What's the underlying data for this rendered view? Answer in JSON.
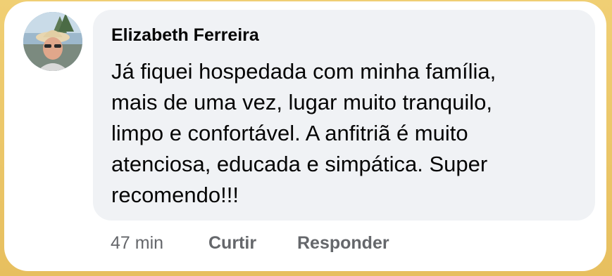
{
  "comment": {
    "author": "Elizabeth Ferreira",
    "lines": [
      "Já fiquei hospedada com minha família,",
      "mais de uma vez, lugar muito tranquilo,",
      "limpo e confortável. A anfitriã é muito",
      "atenciosa, educada e simpática. Super",
      "recomendo!!!"
    ],
    "time": "47 min",
    "like_label": "Curtir",
    "reply_label": "Responder"
  },
  "colors": {
    "background": "#e9c46a",
    "bubble": "#f0f2f5",
    "meta_text": "#65676b"
  },
  "icons": {
    "avatar": "profile-photo"
  }
}
